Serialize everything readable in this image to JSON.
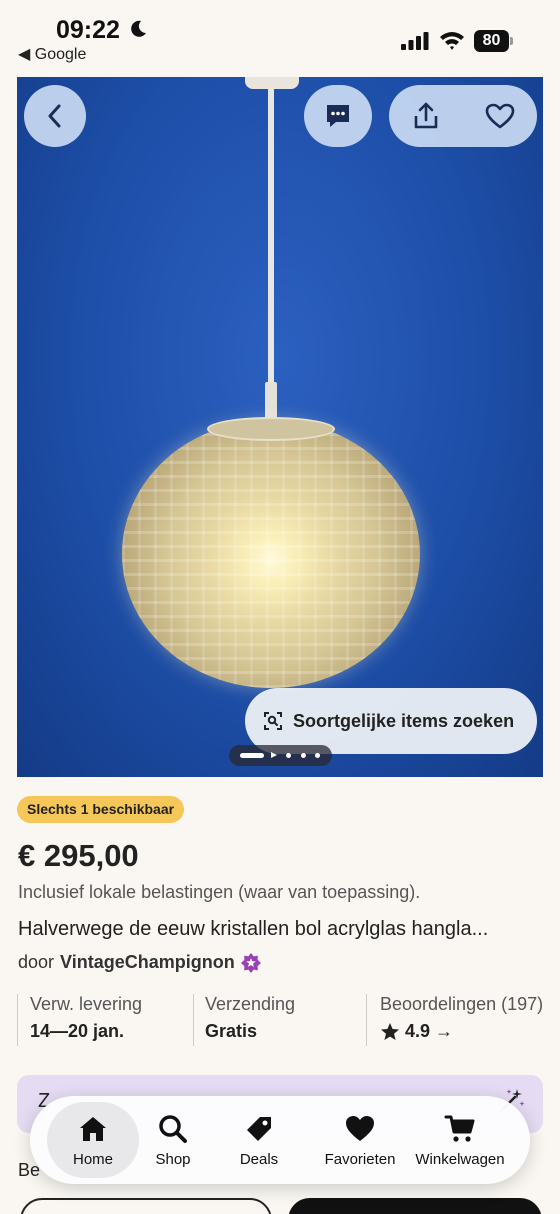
{
  "status_bar": {
    "time": "09:22",
    "back_app": "◀ Google",
    "battery": "80"
  },
  "header": {
    "back_icon": "chevron-left-icon",
    "chat_icon": "chat-bubble-icon",
    "share_icon": "share-icon",
    "favorite_icon": "heart-outline-icon"
  },
  "gallery": {
    "similar_items_label": "Soortgelijke items zoeken",
    "page_count": 5,
    "active_page": 1
  },
  "listing": {
    "availability_badge": "Slechts 1 beschikbaar",
    "price": "€ 295,00",
    "tax_note": "Inclusief lokale belastingen (waar van toepassing).",
    "title": "Halverwege de eeuw kristallen bol acrylglas hangla...",
    "seller_prefix": "door",
    "seller_name": "VintageChampignon"
  },
  "info": {
    "delivery_label": "Verw. levering",
    "delivery_value": "14—20 jan.",
    "shipping_label": "Verzending",
    "shipping_value": "Gratis",
    "reviews_label": "Beoordelingen (197)",
    "reviews_value": "4.9 →"
  },
  "promo": {
    "peek_text": "Z",
    "below_peek_text": "Be"
  },
  "tabbar": {
    "items": [
      {
        "label": "Home",
        "icon": "home-icon"
      },
      {
        "label": "Shop",
        "icon": "search-icon"
      },
      {
        "label": "Deals",
        "icon": "tag-icon"
      },
      {
        "label": "Favorieten",
        "icon": "heart-icon"
      },
      {
        "label": "Winkelwagen",
        "icon": "cart-icon"
      }
    ]
  },
  "colors": {
    "badge": "#f4c758",
    "promo_bg": "#e5dcf3",
    "photo_bg": "#1d4ea8",
    "seller_star": "#9a3fb5"
  }
}
